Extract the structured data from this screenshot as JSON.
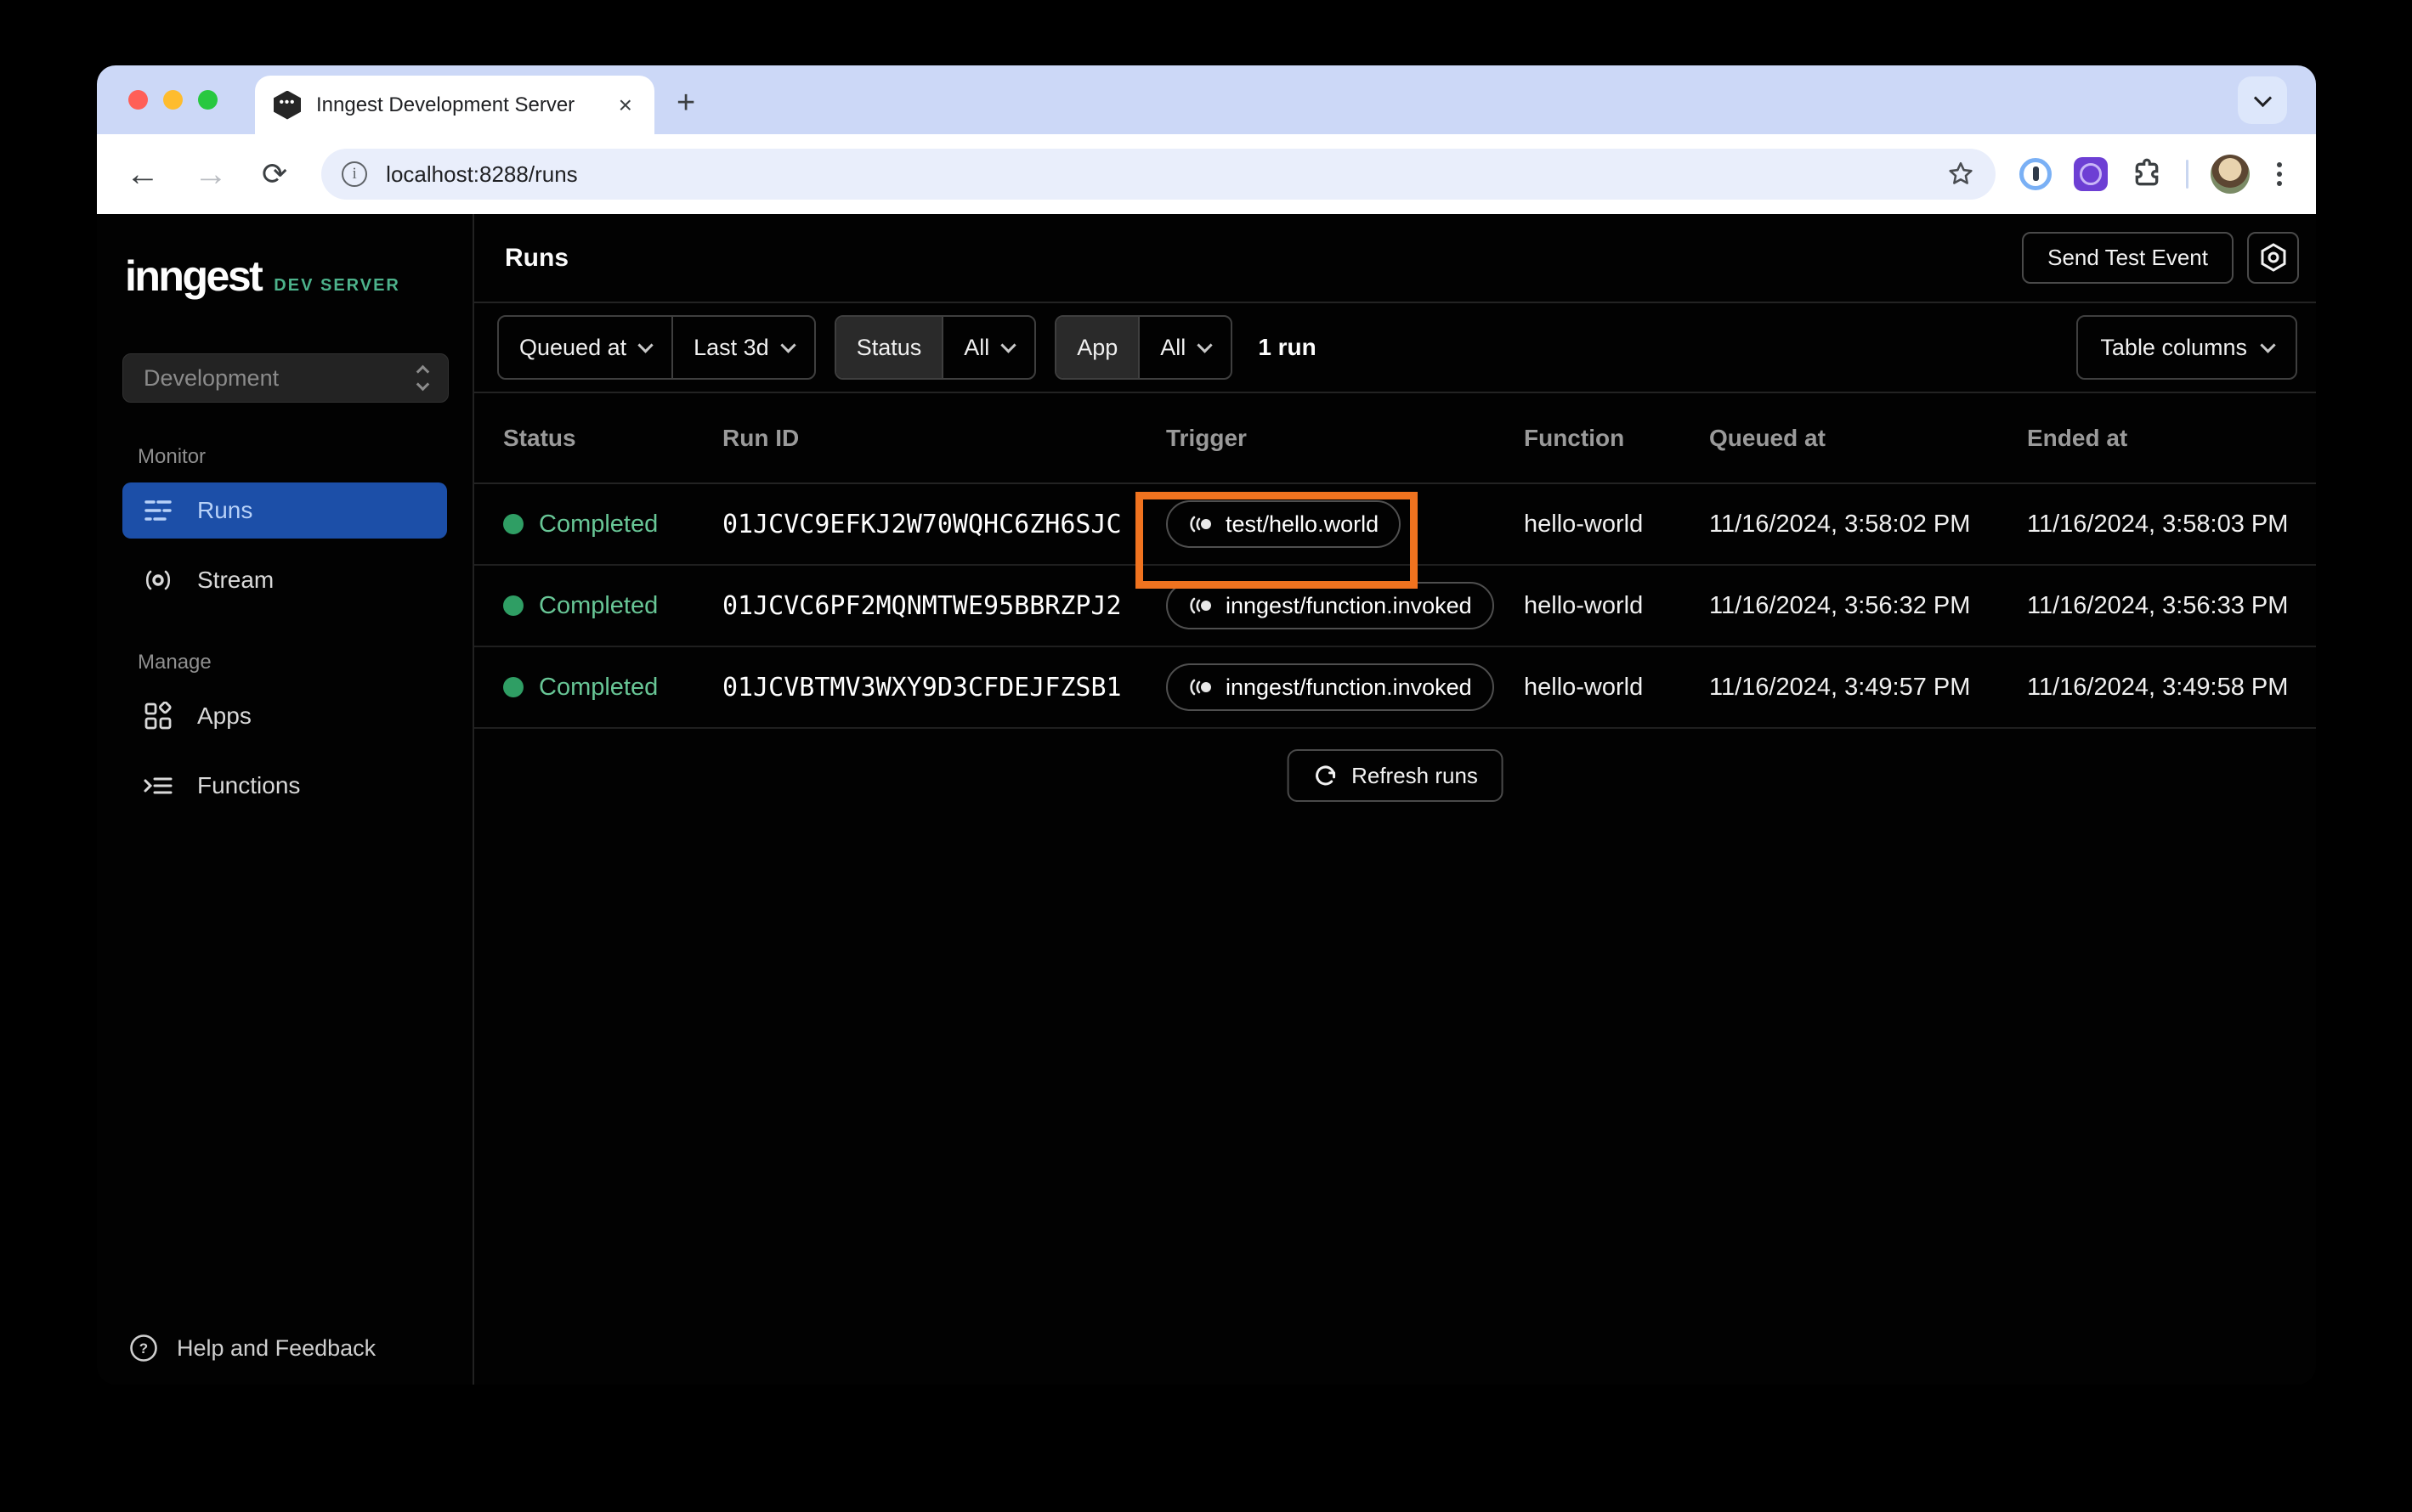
{
  "browser": {
    "tab_title": "Inngest Development Server",
    "url": "localhost:8288/runs"
  },
  "sidebar": {
    "logo": "inngest",
    "badge": "DEV SERVER",
    "env": "Development",
    "monitor_label": "Monitor",
    "runs_label": "Runs",
    "stream_label": "Stream",
    "manage_label": "Manage",
    "apps_label": "Apps",
    "functions_label": "Functions",
    "help_label": "Help and Feedback"
  },
  "header": {
    "title": "Runs",
    "send_test_event": "Send Test Event"
  },
  "filters": {
    "queued_at": "Queued at",
    "range": "Last 3d",
    "status_label": "Status",
    "status_value": "All",
    "app_label": "App",
    "app_value": "All",
    "run_count": "1 run",
    "table_columns": "Table columns"
  },
  "table": {
    "columns": [
      "Status",
      "Run ID",
      "Trigger",
      "Function",
      "Queued at",
      "Ended at"
    ],
    "rows": [
      {
        "status": "Completed",
        "run_id": "01JCVC9EFKJ2W70WQHC6ZH6SJC",
        "trigger": "test/hello.world",
        "function": "hello-world",
        "queued_at": "11/16/2024, 3:58:02 PM",
        "ended_at": "11/16/2024, 3:58:03 PM",
        "highlighted": true
      },
      {
        "status": "Completed",
        "run_id": "01JCVC6PF2MQNMTWE95BBRZPJ2",
        "trigger": "inngest/function.invoked",
        "function": "hello-world",
        "queued_at": "11/16/2024, 3:56:32 PM",
        "ended_at": "11/16/2024, 3:56:33 PM",
        "highlighted": false
      },
      {
        "status": "Completed",
        "run_id": "01JCVBTMV3WXY9D3CFDEJFZSB1",
        "trigger": "inngest/function.invoked",
        "function": "hello-world",
        "queued_at": "11/16/2024, 3:49:57 PM",
        "ended_at": "11/16/2024, 3:49:58 PM",
        "highlighted": false
      }
    ],
    "refresh_label": "Refresh runs"
  },
  "colors": {
    "active_nav_blue": "#1c4fa8",
    "dev_server_green": "#4db28b",
    "status_green": "#68c696",
    "status_dot_green": "#2f9e64",
    "highlight_orange": "#f0731f",
    "tabstrip_blue": "#ccd8f7"
  },
  "icons": {
    "traffic_lights": "red-yellow-green circles",
    "favicon": "inngest-hexagon-ellipsis",
    "trigger": "event-broadcast",
    "settings": "hex-nut-gear",
    "refresh": "circular-arrows",
    "help": "question-circle"
  }
}
